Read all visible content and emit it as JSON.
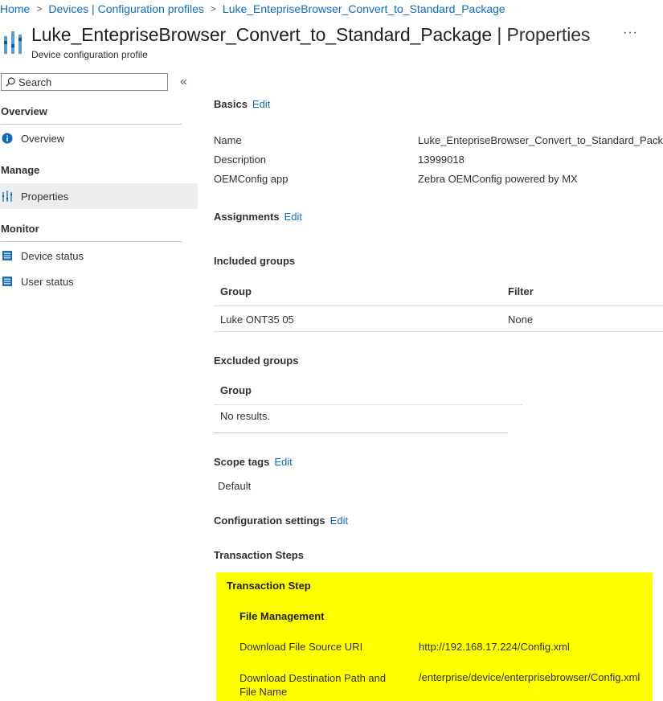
{
  "breadcrumb": {
    "items": [
      "Home",
      "Devices | Configuration profiles",
      "Luke_EntepriseBrowser_Convert_to_Standard_Package"
    ]
  },
  "header": {
    "title": "Luke_EntepriseBrowser_Convert_to_Standard_Package",
    "title_suffix": "| Properties",
    "subtitle": "Device configuration profile",
    "more_label": "···",
    "icon": "policy-bars-icon"
  },
  "sidebar": {
    "search_placeholder": "Search",
    "collapse_label": "«",
    "sections": [
      {
        "title": "Overview",
        "items": [
          {
            "label": "Overview",
            "icon": "info-icon"
          }
        ]
      },
      {
        "title": "Manage",
        "items": [
          {
            "label": "Properties",
            "icon": "properties-icon",
            "selected": true
          }
        ]
      },
      {
        "title": "Monitor",
        "items": [
          {
            "label": "Device status",
            "icon": "report-icon"
          },
          {
            "label": "User status",
            "icon": "report-icon"
          }
        ]
      }
    ]
  },
  "basics": {
    "title": "Basics",
    "edit": "Edit",
    "rows": [
      {
        "label": "Name",
        "value": "Luke_EntepriseBrowser_Convert_to_Standard_Package"
      },
      {
        "label": "Description",
        "value": "13999018"
      },
      {
        "label": "OEMConfig app",
        "value": "Zebra OEMConfig powered by MX"
      }
    ]
  },
  "assignments": {
    "title": "Assignments",
    "edit": "Edit",
    "included": {
      "title": "Included groups",
      "headers": [
        "Group",
        "Filter"
      ],
      "rows": [
        [
          "Luke ONT35 05",
          "None"
        ]
      ]
    },
    "excluded": {
      "title": "Excluded groups",
      "headers": [
        "Group"
      ],
      "empty": "No results."
    }
  },
  "scope": {
    "title": "Scope tags",
    "edit": "Edit",
    "value": "Default"
  },
  "config": {
    "title": "Configuration settings",
    "edit": "Edit",
    "steps_title": "Transaction Steps",
    "step_title": "Transaction Step",
    "group_title": "File Management",
    "rows": [
      {
        "label": "Download File Source URI",
        "value": "http://192.168.17.224/Config.xml"
      },
      {
        "label": "Download Destination Path and File Name",
        "value": "/enterprise/device/enterprisebrowser/Config.xml"
      }
    ]
  },
  "colors": {
    "link": "#0f6cbd",
    "highlight": "#ffff00",
    "selected_bg": "#ededed"
  }
}
